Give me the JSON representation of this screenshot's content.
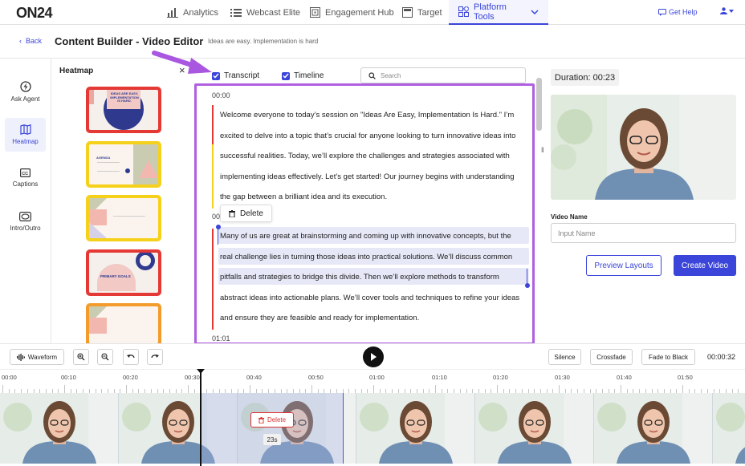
{
  "app": {
    "logo": "ON24"
  },
  "nav": {
    "items": [
      {
        "label": "Analytics",
        "icon": "bar-chart-icon"
      },
      {
        "label": "Webcast Elite",
        "icon": "list-icon"
      },
      {
        "label": "Engagement Hub",
        "icon": "hub-icon"
      },
      {
        "label": "Target",
        "icon": "target-icon"
      },
      {
        "label": "Platform Tools",
        "icon": "grid-icon",
        "active": true
      }
    ],
    "get_help": "Get Help"
  },
  "header": {
    "back": "Back",
    "title": "Content Builder - Video Editor",
    "tagline": "Ideas are easy. Implementation is hard"
  },
  "rail": {
    "items": [
      {
        "label": "Ask Agent",
        "icon": "lightning-icon"
      },
      {
        "label": "Heatmap",
        "icon": "map-icon",
        "active": true
      },
      {
        "label": "Captions",
        "icon": "captions-icon"
      },
      {
        "label": "Intro/Outro",
        "icon": "intro-outro-icon"
      }
    ]
  },
  "heatmap": {
    "title": "Heatmap",
    "close": "×",
    "slides": [
      {
        "text": "IDEAS ARE EASY, IMPLEMENTATION IS HARD.",
        "border": "#e53935"
      },
      {
        "text": "AGENDA",
        "border": "#f6d11b"
      },
      {
        "text": "",
        "border": "#f6d11b"
      },
      {
        "text": "PRIMARY GOALS",
        "border": "#e53935"
      },
      {
        "text": "",
        "border": "#f39c2b"
      }
    ]
  },
  "editor": {
    "transcript_label": "Transcript",
    "timeline_label": "Timeline",
    "search_placeholder": "Search",
    "timestamps": [
      "00:00",
      "00",
      "01:01"
    ],
    "paragraph1": [
      "Welcome everyone to today’s session on \"Ideas Are Easy, Implementation Is Hard.\" I’m",
      "excited to delve into a topic that’s crucial for anyone looking to turn innovative ideas into",
      "successful realities. Today, we’ll explore the challenges and strategies associated with",
      "implementing ideas effectively. Let’s get started! Our journey begins with understanding",
      "the gap between a brilliant idea and its execution."
    ],
    "paragraph2": [
      "Many of us are great at brainstorming and coming up with innovative concepts, but the",
      "real challenge lies in turning those ideas into practical solutions. We’ll discuss common",
      "pitfalls and strategies to bridge this divide. Then we’ll explore methods to transform",
      "abstract ideas into actionable plans. We’ll cover tools and techniques to refine your ideas",
      "and ensure they are feasible and ready for implementation."
    ],
    "delete_label": "Delete"
  },
  "right": {
    "duration": "Duration: 00:23",
    "video_name_label": "Video Name",
    "video_name_placeholder": "Input Name",
    "preview_layouts": "Preview Layouts",
    "create_video": "Create Video"
  },
  "toolbar": {
    "waveform": "Waveform",
    "silence": "Silence",
    "crossfade": "Crossfade",
    "fade_to_black": "Fade to Black",
    "timecode": "00:00:32"
  },
  "timeline": {
    "ticks": [
      "00:00",
      "00:10",
      "00:20",
      "00:30",
      "00:40",
      "00:50",
      "01:00",
      "01:10",
      "01:20",
      "01:30",
      "01:40",
      "01:50"
    ],
    "clip_delete": "Delete",
    "clip_duration": "23s"
  }
}
